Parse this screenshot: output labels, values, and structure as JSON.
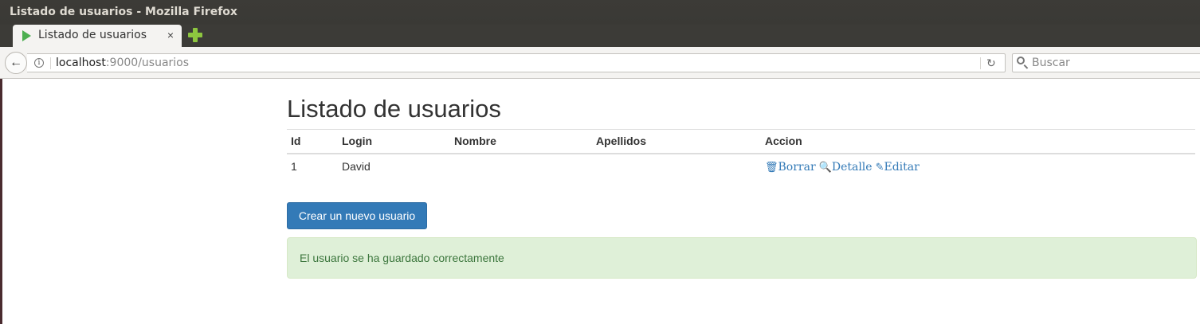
{
  "window": {
    "title": "Listado de usuarios - Mozilla Firefox"
  },
  "tab": {
    "title": "Listado de usuarios",
    "close": "×"
  },
  "navbar": {
    "back": "←",
    "url_host": "localhost",
    "url_path": ":9000/usuarios",
    "reload": "↻",
    "search_placeholder": "Buscar"
  },
  "page": {
    "title": "Listado de usuarios",
    "table": {
      "headers": [
        "Id",
        "Login",
        "Nombre",
        "Apellidos",
        "Accion"
      ],
      "rows": [
        {
          "id": "1",
          "login": "David",
          "nombre": "",
          "apellidos": ""
        }
      ],
      "actions": {
        "borrar": "Borrar",
        "detalle": "Detalle",
        "editar": "Editar"
      }
    },
    "create_button": "Crear un nuevo usuario",
    "alert": "El usuario se ha guardado correctamente"
  },
  "icons": {
    "trash": "trash-icon",
    "zoom": "zoom-in-icon",
    "pencil": "pencil-icon"
  },
  "colors": {
    "link": "#337ab7",
    "alert_bg": "#dff0d8",
    "alert_text": "#3c763d",
    "primary": "#337ab7"
  }
}
